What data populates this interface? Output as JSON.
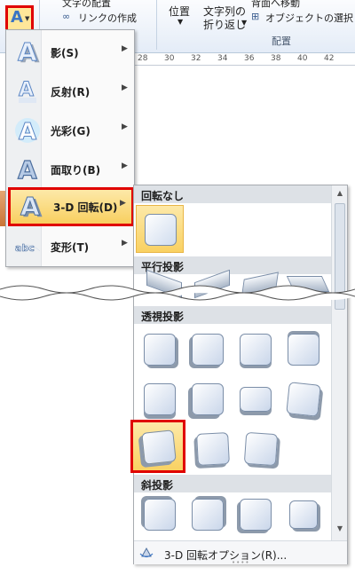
{
  "ribbon": {
    "top_left_text": "文字の配置",
    "link_text": "リンクの作成",
    "position_label": "位置",
    "wrap_label_line1": "文字列の",
    "wrap_label_line2": "折り返し",
    "bring_text": "背面へ移動",
    "select_objects_text": "オブジェクトの選択と表",
    "group_label": "配置"
  },
  "ruler": {
    "numbers": [
      "28",
      "30",
      "32",
      "34",
      "36",
      "38",
      "40",
      "42"
    ]
  },
  "menu": {
    "items": [
      {
        "label": "影(S)",
        "icon": "shadow-A-icon"
      },
      {
        "label": "反射(R)",
        "icon": "reflection-A-icon"
      },
      {
        "label": "光彩(G)",
        "icon": "glow-A-icon"
      },
      {
        "label": "面取り(B)",
        "icon": "bevel-A-icon"
      },
      {
        "label": "3-D 回転(D)",
        "icon": "3d-rotation-A-icon",
        "active": true
      },
      {
        "label": "変形(T)",
        "icon": "transform-abc-icon"
      }
    ]
  },
  "submenu": {
    "sections": [
      "回転なし",
      "平行投影",
      "透視投影",
      "斜投影"
    ],
    "footer": "3-D 回転オプション(R)..."
  }
}
